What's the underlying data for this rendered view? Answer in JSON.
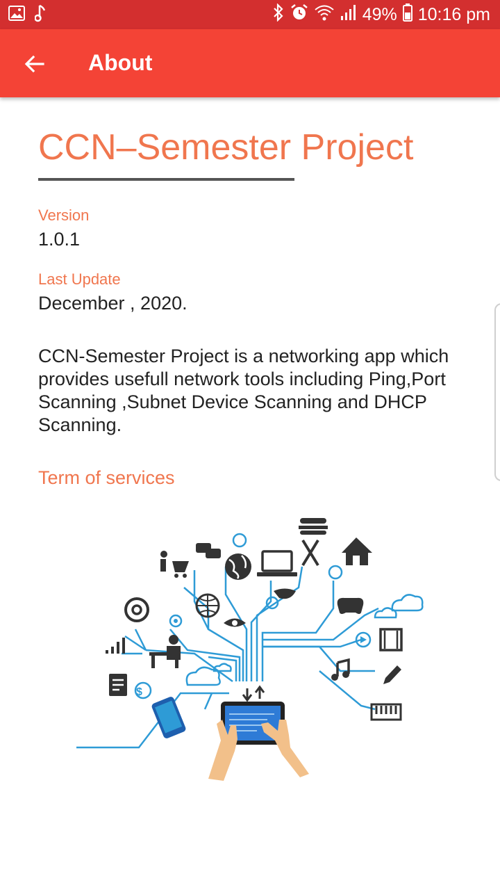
{
  "status_bar": {
    "battery": "49%",
    "time": "10:16 pm",
    "icons": [
      "gallery-icon",
      "music-note-icon",
      "bluetooth-icon",
      "alarm-icon",
      "wifi-icon",
      "signal-icon",
      "battery-icon"
    ]
  },
  "app_bar": {
    "title": "About",
    "back_icon": "arrow-left-icon"
  },
  "project_title": "CCN–Semester Project",
  "version": {
    "label": "Version",
    "value": "1.0.1"
  },
  "last_update": {
    "label": "Last Update",
    "value": "December , 2020."
  },
  "description": "CCN-Semester Project is a networking app which provides usefull network tools including Ping,Port Scanning ,Subnet Device Scanning and DHCP Scanning.",
  "terms_link": "Term of services",
  "colors": {
    "status_bar": "#d32f2f",
    "app_bar": "#f44336",
    "accent_text": "#f0764e",
    "body_text": "#222222",
    "illustration_lines": "#2e9bd6"
  }
}
